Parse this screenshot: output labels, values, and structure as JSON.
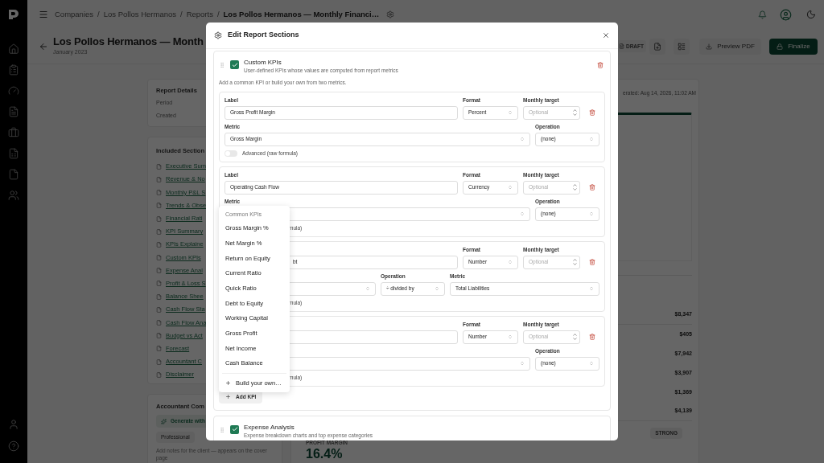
{
  "breadcrumb_separator": "/",
  "breadcrumb": [
    "Companies",
    "Los Pollos Hermanos",
    "Reports",
    "Los Pollos Hermanos — Monthly Financi…"
  ],
  "header": {
    "title": "Los Pollos Hermanos — Month",
    "subtitle": "January 2023",
    "status": "DRAFT",
    "preview_button": "Preview PDF",
    "finalize_button": "Finalize"
  },
  "details_card": {
    "title": "Report Details",
    "rows": [
      "Period",
      "Created"
    ]
  },
  "sections_card": {
    "title": "Included Section",
    "links": [
      "Executive Sum",
      "Revenue & No",
      "Monthly P&L S",
      "Trends & Obse",
      "Financial Rati",
      "KPI Summary",
      "KPIs Explaine",
      "Custom KPIs",
      "Expense Anal",
      "Profit & Loss S",
      "Balance Shee",
      "Cash Flow Sta",
      "Cash Flow Ana",
      "Budget vs Act",
      "Forecast",
      "Accountant C",
      "Disclaimer"
    ]
  },
  "comments_card": {
    "title": "Accountant Com",
    "generate_button": "Generate with",
    "tabs": [
      {
        "label": "Professional",
        "selected": true
      }
    ],
    "hint": "Add notes for the client — appears on the cover page"
  },
  "report": {
    "generated": "erated: Aug 14, 2026, 11:02 AM",
    "amounts": [
      "$8,347",
      "$405",
      "$7,942",
      "$3,907",
      "$1,369",
      "$4,139"
    ],
    "metric_label": "PROFIT MARGIN",
    "metric_value": "16.4%",
    "badge": "STRONG"
  },
  "modal": {
    "title": "Edit Report Sections",
    "sections": [
      {
        "title": "Custom KPIs",
        "description": "User-defined KPIs whose values are computed from report metrics",
        "checked": true,
        "hint": "Add a common KPI or build your own from two metrics.",
        "add_button": "Add KPI",
        "kpis": [
          {
            "label": {
              "kind": "full",
              "caption": "Label",
              "value": "Gross Profit Margin"
            },
            "format_caption": "Format",
            "format": "Percent",
            "target_caption": "Monthly target",
            "target_placeholder": "Optional",
            "row2": {
              "kind": "single",
              "selects": [
                {
                  "caption": "Metric",
                  "value": "Gross Margin"
                },
                {
                  "caption": "Operation",
                  "value": "(none)"
                }
              ]
            },
            "advanced": {
              "kind": "toggle",
              "text": "Advanced (raw formula)",
              "on": false
            }
          },
          {
            "label": {
              "kind": "full",
              "caption": "Label",
              "value": "Operating Cash Flow"
            },
            "format_caption": "Format",
            "format": "Currency",
            "target_caption": "Monthly target",
            "target_placeholder": "Optional",
            "row2": {
              "kind": "single",
              "selects": [
                {
                  "caption": "Metric"
                },
                {
                  "caption": "Operation",
                  "value": "(none)"
                }
              ]
            },
            "advanced": {
              "kind": "clipped",
              "text": "mula)"
            }
          },
          {
            "label": {
              "kind": "clipped",
              "value": "bt"
            },
            "format_caption": "Format",
            "format": "Number",
            "target_caption": "Monthly target",
            "target_placeholder": "Optional",
            "row2": {
              "kind": "ratio",
              "selects": [
                {
                  "caption": "Operation",
                  "value": "÷ divided by"
                },
                {
                  "caption": "Metric",
                  "value": "Total Liabilities"
                }
              ]
            },
            "advanced": {
              "kind": "clipped",
              "text": "mula)"
            }
          },
          {
            "label": {
              "kind": "clipped"
            },
            "format_caption": "Format",
            "format": "Number",
            "target_caption": "Monthly target",
            "target_placeholder": "Optional",
            "row2": {
              "kind": "single",
              "selects": [
                {
                  "caption": "Operation",
                  "value": "(none)"
                }
              ]
            },
            "advanced": {
              "kind": "clipped",
              "text": "mula)"
            }
          }
        ]
      },
      {
        "title": "Expense Analysis",
        "description": "Expense breakdown charts and top expense categories",
        "checked": true
      }
    ],
    "menu": {
      "heading": "Common KPIs",
      "items": [
        "Gross Margin %",
        "Net Margin %",
        "Return on Equity",
        "Current Ratio",
        "Quick Ratio",
        "Debt to Equity",
        "Working Capital",
        "Gross Profit",
        "Net Income",
        "Cash Balance"
      ],
      "build_item": "Build your own…"
    }
  }
}
